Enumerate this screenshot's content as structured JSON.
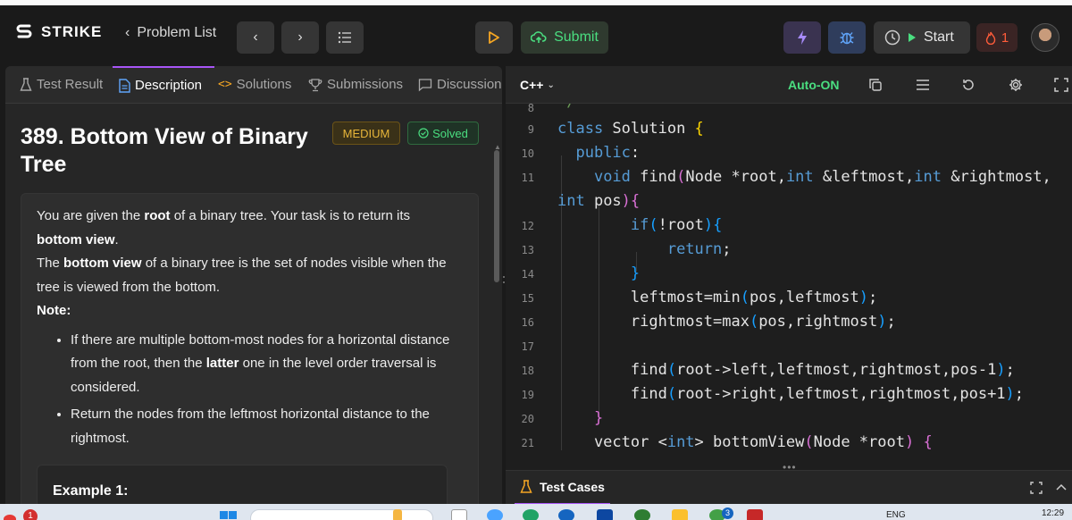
{
  "header": {
    "logo_text": "STRIKE",
    "problem_list_label": "Problem List",
    "submit_label": "Submit",
    "start_label": "Start",
    "streak_count": "1"
  },
  "left_tabs": [
    {
      "label": "Test Result"
    },
    {
      "label": "Description"
    },
    {
      "label": "Solutions"
    },
    {
      "label": "Submissions"
    },
    {
      "label": "Discussion"
    }
  ],
  "problem": {
    "title": "389. Bottom View of Binary Tree",
    "difficulty": "MEDIUM",
    "status": "Solved",
    "para1_a": "You are given the ",
    "para1_b": "root",
    "para1_c": " of a binary tree. Your task is to return its ",
    "para1_d": "bottom view",
    "para1_e": ".",
    "para2_a": "The ",
    "para2_b": "bottom view",
    "para2_c": " of a binary tree is the set of nodes visible when the tree is viewed from the bottom.",
    "note_label": "Note:",
    "bullet1_a": "If there are multiple bottom-most nodes for a horizontal distance from the root, then the ",
    "bullet1_b": "latter",
    "bullet1_c": " one in the level order traversal is considered.",
    "bullet2": "Return the nodes from the leftmost horizontal distance to the rightmost.",
    "example_title": "Example 1:"
  },
  "editor": {
    "language": "C++",
    "auto_label": "Auto-ON",
    "line_numbers": [
      "8",
      "9",
      "10",
      "11",
      "",
      "12",
      "13",
      "14",
      "15",
      "16",
      "17",
      "18",
      "19",
      "20",
      "21"
    ]
  },
  "bottom_panel": {
    "test_cases_label": "Test Cases"
  },
  "taskbar": {
    "lang": "ENG",
    "time": "12:29",
    "notif": "1",
    "badge3": "3"
  },
  "colors": {
    "accent": "#a855f7",
    "green": "#4ade80",
    "medium": "#e7b53a"
  }
}
